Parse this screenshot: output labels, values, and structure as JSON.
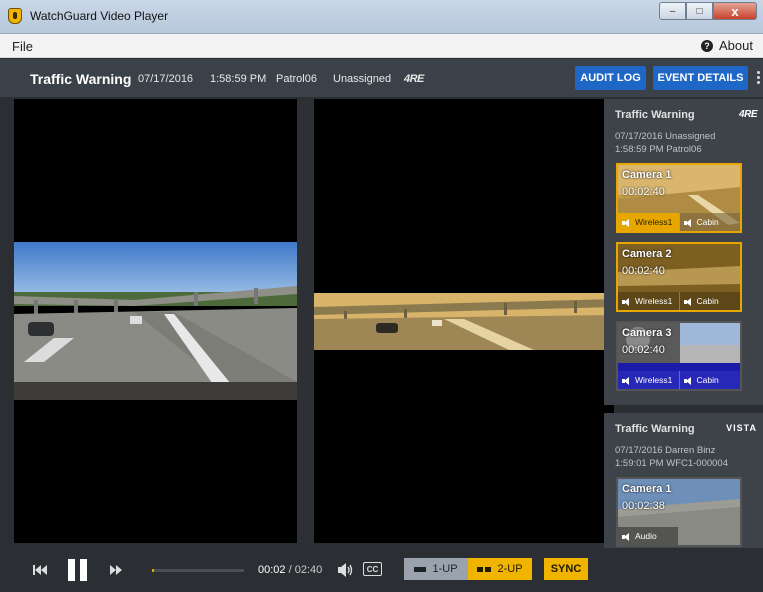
{
  "window": {
    "title": "WatchGuard Video Player",
    "minimize": "–",
    "maximize": "□",
    "close": "x"
  },
  "menu": {
    "file": "File",
    "about": "About",
    "about_icon": "?"
  },
  "header": {
    "title": "Traffic Warning",
    "date": "07/17/2016",
    "time": "1:58:59 PM",
    "officer": "Patrol06",
    "status": "Unassigned",
    "brand": "4RE",
    "audit_log": "AUDIT LOG",
    "event_details": "EVENT DETAILS"
  },
  "events": [
    {
      "title": "Traffic Warning",
      "brand": "4RE",
      "line1": "07/17/2016   Unassigned",
      "line2": "1:58:59 PM   Patrol06",
      "cameras": [
        {
          "label": "Camera 1",
          "time": "00:02:40",
          "audio": [
            "Wireless1",
            "Cabin"
          ]
        },
        {
          "label": "Camera 2",
          "time": "00:02:40",
          "audio": [
            "Wireless1",
            "Cabin"
          ]
        },
        {
          "label": "Camera 3",
          "time": "00:02:40",
          "audio": [
            "Wireless1",
            "Cabin"
          ]
        }
      ]
    },
    {
      "title": "Traffic Warning",
      "brand": "VISTA",
      "line1": "07/17/2016   Darren Binz",
      "line2": "1:59:01 PM   WFC1-000004",
      "cameras": [
        {
          "label": "Camera 1",
          "time": "00:02:38",
          "audio": [
            "Audio"
          ]
        }
      ]
    }
  ],
  "playback": {
    "current": "00:02",
    "separator": " / ",
    "duration": "02:40",
    "progress": 0.02,
    "cc": "CC",
    "one_up": "1-UP",
    "two_up": "2-UP",
    "sync": "SYNC"
  },
  "colors": {
    "accent": "#e8a600",
    "button_blue": "#1f67c7",
    "header_bg": "#3b4148"
  }
}
